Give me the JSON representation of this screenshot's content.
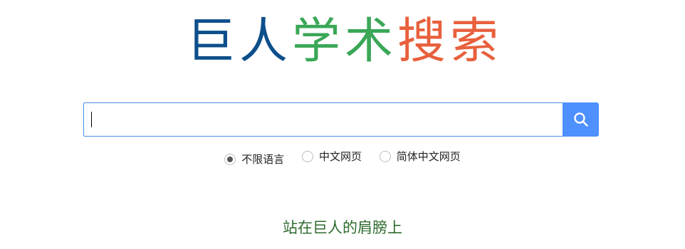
{
  "logo": {
    "chars": [
      "巨",
      "人",
      "学",
      "术",
      "搜",
      "索"
    ],
    "colors": [
      "#0d4f8b",
      "#0d4f8b",
      "#3aa757",
      "#3aa757",
      "#e8603c",
      "#e8603c"
    ]
  },
  "search": {
    "value": "",
    "placeholder": "",
    "button_icon": "search-icon",
    "button_color": "#4d90fe",
    "border_color": "#4a90e2"
  },
  "language_options": [
    {
      "label": "不限语言",
      "selected": true
    },
    {
      "label": "中文网页",
      "selected": false
    },
    {
      "label": "简体中文网页",
      "selected": false
    }
  ],
  "slogan": {
    "text": "站在巨人的肩膀上",
    "color": "#2e6b2e"
  }
}
